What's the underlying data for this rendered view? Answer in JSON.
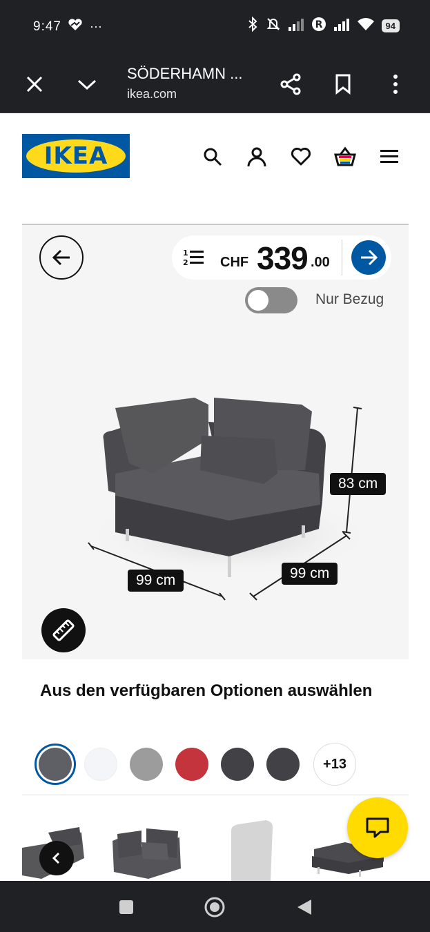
{
  "status_bar": {
    "time": "9:47",
    "dots": "···",
    "battery": "94"
  },
  "browser": {
    "title": "SÖDERHAMN ...",
    "url": "ikea.com"
  },
  "logo": {
    "text": "IKEA"
  },
  "price": {
    "currency": "CHF",
    "integer": "339",
    "decimal": ".00"
  },
  "toggle": {
    "label": "Nur Bezug",
    "on": false
  },
  "dimensions": {
    "height": "83 cm",
    "depth": "99 cm",
    "width": "99 cm"
  },
  "options": {
    "title": "Aus den verfügbaren Optionen auswählen",
    "swatches": [
      {
        "color": "#5f6065",
        "selected": true
      },
      {
        "color": "#f3f5f8",
        "selected": false
      },
      {
        "color": "#9c9c9c",
        "selected": false
      },
      {
        "color": "#c4343c",
        "selected": false
      },
      {
        "color": "#414146",
        "selected": false
      },
      {
        "color": "#414146",
        "selected": false
      }
    ],
    "more_label": "+13"
  },
  "colors": {
    "ikea_blue": "#0058a3",
    "ikea_yellow": "#ffda1a",
    "chat_yellow": "#ffdb00",
    "dark_bar": "#202124"
  }
}
